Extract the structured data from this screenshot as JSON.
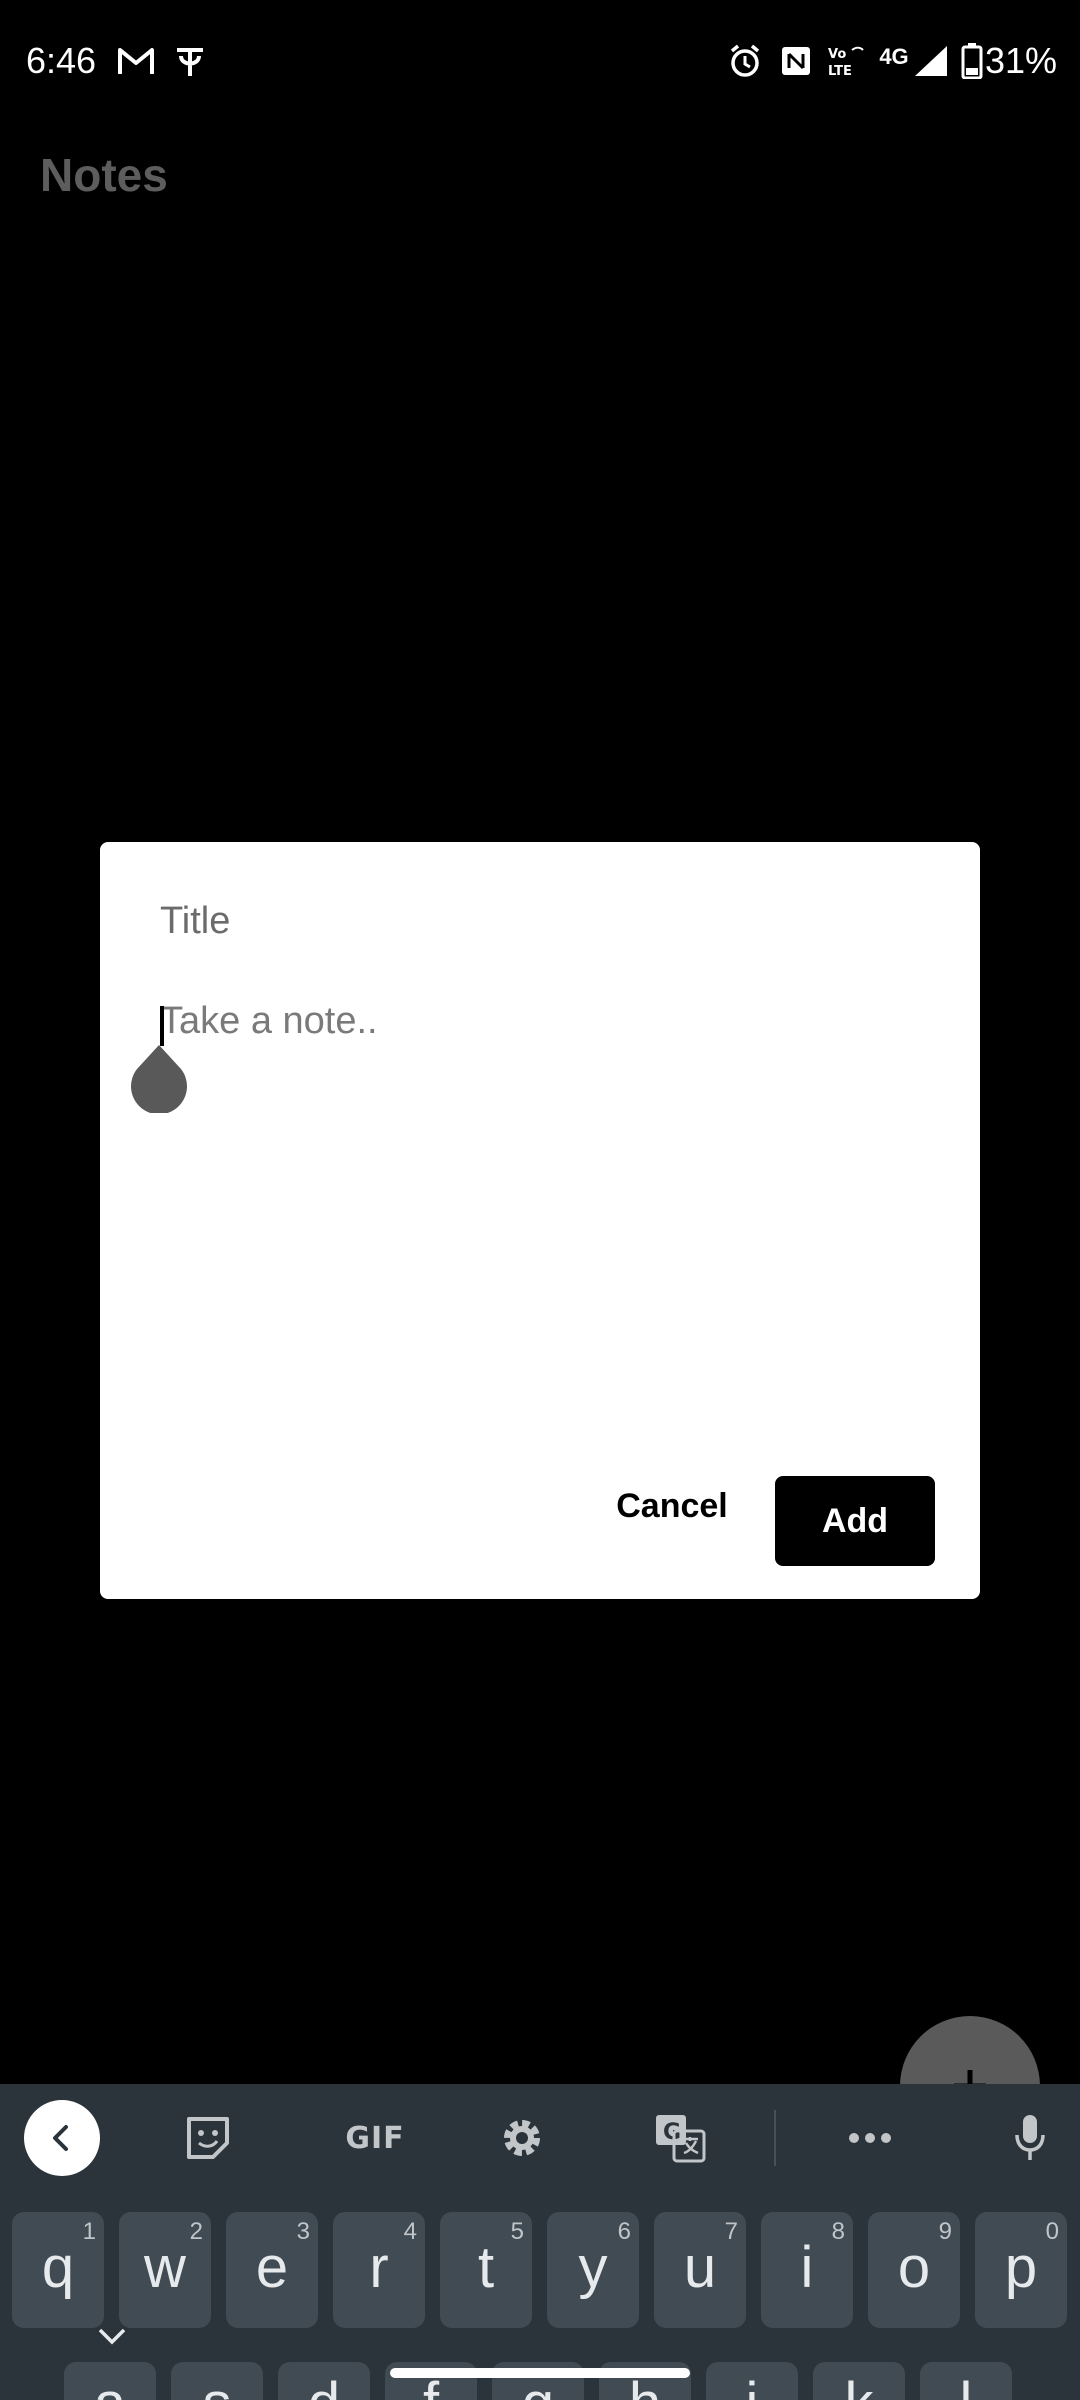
{
  "status_bar": {
    "time": "6:46",
    "battery_percent": "31%",
    "network": "4G",
    "volte": "Vo LTE",
    "icons": [
      "gmail-icon",
      "phonepe-icon",
      "alarm-icon",
      "nfc-icon",
      "volte-icon",
      "signal-icon",
      "battery-icon"
    ]
  },
  "app": {
    "title": "Notes"
  },
  "dialog": {
    "title_placeholder": "Title",
    "note_placeholder": "Take a note..",
    "cancel_label": "Cancel",
    "add_label": "Add"
  },
  "keyboard": {
    "toolbar": {
      "gif_label": "GIF"
    },
    "row1": [
      {
        "letter": "q",
        "num": "1"
      },
      {
        "letter": "w",
        "num": "2"
      },
      {
        "letter": "e",
        "num": "3"
      },
      {
        "letter": "r",
        "num": "4"
      },
      {
        "letter": "t",
        "num": "5"
      },
      {
        "letter": "y",
        "num": "6"
      },
      {
        "letter": "u",
        "num": "7"
      },
      {
        "letter": "i",
        "num": "8"
      },
      {
        "letter": "o",
        "num": "9"
      },
      {
        "letter": "p",
        "num": "0"
      }
    ],
    "row2": [
      "a",
      "s",
      "d",
      "f",
      "g",
      "h",
      "j",
      "k",
      "l"
    ]
  },
  "colors": {
    "background": "#000000",
    "dialog": "#ffffff",
    "add_button": "#000000",
    "keyboard": "#2b343b",
    "key": "#414b53",
    "fab": "#5a5a5a"
  }
}
